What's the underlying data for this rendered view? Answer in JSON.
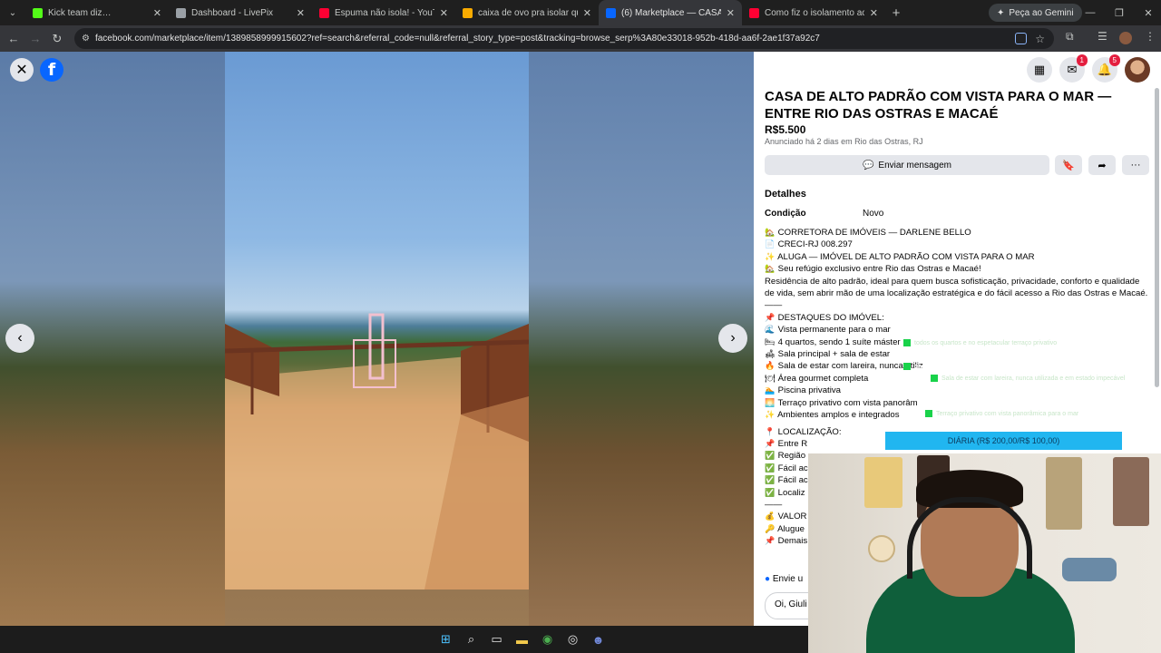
{
  "browser": {
    "tabs": [
      {
        "title": "Kick team diz…",
        "color": "#53fc18"
      },
      {
        "title": "Dashboard - LivePix",
        "color": "#9aa0a6"
      },
      {
        "title": "Espuma não isola! - YouTube",
        "color": "#ff0033"
      },
      {
        "title": "caixa de ovo pra isolar quarto -",
        "color": "#f9ab00"
      },
      {
        "title": "(6) Marketplace — CASA DE AL…",
        "color": "#0866ff"
      },
      {
        "title": "Como fiz o isolamento acústico",
        "color": "#ff0033"
      }
    ],
    "gemini_label": "Peça ao Gemini",
    "url": "facebook.com/marketplace/item/1389858999915602?ref=search&referral_code=null&referral_story_type=post&tracking=browse_serp%3A80e33018-952b-418d-aa6f-2ae1f37a92c7"
  },
  "viewer": {
    "thumb_colors": [
      "#8a7a60",
      "#7aa0c8",
      "#b09070",
      "#8aa070",
      "#b09a70",
      "#c09070",
      "#a08a60",
      "#b08060",
      "#c0a080",
      "#a09060"
    ]
  },
  "listing": {
    "title": "CASA DE ALTO PADRÃO COM VISTA PARA O MAR — ENTRE RIO DAS OSTRAS E MACAÉ",
    "price": "R$5.500",
    "listed": "Anunciado há 2 dias em Rio das Ostras, RJ",
    "message_button": "Enviar mensagem",
    "badges": {
      "messenger": "1",
      "notifications": "5"
    },
    "details_heading": "Detalhes",
    "condition_label": "Condição",
    "condition_value": "Novo",
    "desc_lines": [
      {
        "icon": "🏡",
        "text": "CORRETORA DE IMÓVEIS — DARLENE BELLO"
      },
      {
        "icon": "📄",
        "text": "CRECI-RJ 008.297"
      },
      {
        "icon": "✨",
        "text": "ALUGA — IMÓVEL DE ALTO PADRÃO COM VISTA PARA O MAR"
      },
      {
        "icon": "🏡",
        "text": "Seu refúgio exclusivo entre Rio das Ostras e Macaé!"
      }
    ],
    "paragraph": "Residência de alto padrão, ideal para quem busca sofisticação, privacidade, conforto e qualidade de vida, sem abrir mão de uma localização estratégica e do fácil acesso a Rio das Ostras e Macaé.",
    "separator": "——",
    "highlights_heading": "DESTAQUES DO IMÓVEL:",
    "highlights": [
      {
        "icon": "🌊",
        "text": "Vista permanente para o mar"
      },
      {
        "icon": "🛏",
        "text": "4 quartos, sendo 1 suíte máster"
      },
      {
        "icon": "🛋",
        "text": "Sala principal + sala de estar"
      },
      {
        "icon": "🔥",
        "text": "Sala de estar com lareira, nunca utiliz"
      },
      {
        "icon": "🍽",
        "text": "Área gourmet completa"
      },
      {
        "icon": "🏊",
        "text": "Piscina privativa"
      },
      {
        "icon": "🌅",
        "text": "Terraço privativo com vista panorâm"
      },
      {
        "icon": "✨",
        "text": "Ambientes amplos e integrados"
      }
    ],
    "location_heading": "LOCALIZAÇÃO:",
    "location_lines": [
      {
        "icon": "📌",
        "text": "Entre R"
      },
      {
        "icon": "✅",
        "text": "Região"
      },
      {
        "icon": "✅",
        "text": "Fácil ac"
      },
      {
        "icon": "✅",
        "text": "Fácil ac"
      },
      {
        "icon": "✅",
        "text": "Localiz"
      }
    ],
    "value_lines": [
      {
        "icon": "💰",
        "text": "VALOR"
      },
      {
        "icon": "🔑",
        "text": "Alugue"
      },
      {
        "icon": "📌",
        "text": "Demais"
      }
    ],
    "send_label": "Envie u",
    "chat_placeholder": "Oi, Giuli"
  },
  "stream_overlay": {
    "rows": [
      "todos os quartos e no espetacular terraço privativo",
      "Sala de estar com lareira, nunca utilizada e em estado impecável",
      "Terraço privativo com vista panorâmica para o mar"
    ],
    "chat_user": "gamerCRVG",
    "daily_rate": "DIÁRIA (R$ 200,00/R$ 100,00)"
  }
}
